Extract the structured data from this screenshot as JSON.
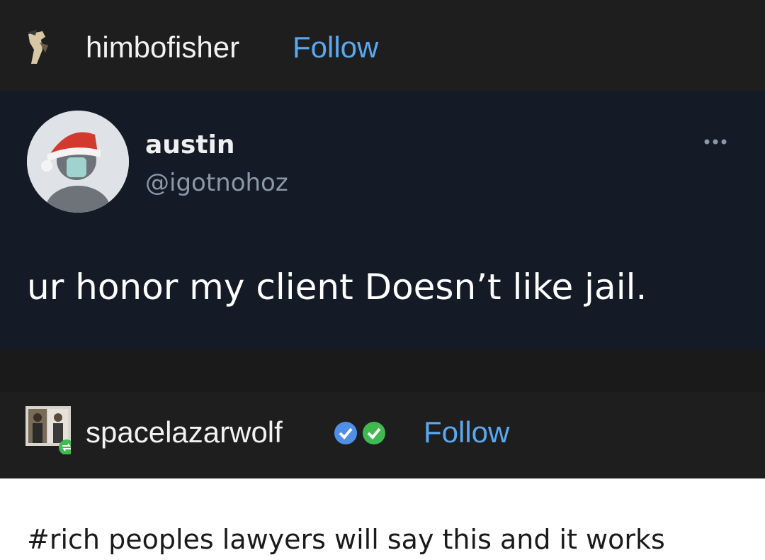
{
  "post": {
    "username": "himbofisher",
    "follow_label": "Follow",
    "avatar_icon": "user-avatar-icon"
  },
  "tweet": {
    "name": "austin",
    "handle": "@igotnohoz",
    "text": "ur honor my client Doesn’t like jail.",
    "more_icon": "more-options-icon"
  },
  "reblog": {
    "username": "spacelazarwolf",
    "follow_label": "Follow",
    "badges": [
      "verified-blue-icon",
      "verified-green-icon"
    ],
    "reblog_icon": "reblog-icon"
  },
  "comment": {
    "text": "#rich peoples lawyers will say this and it works"
  },
  "colors": {
    "follow": "#5aa8f0",
    "tweet_bg": "#141b27",
    "header_bg": "#1e1e1e",
    "reblog_badge": "#3fb950"
  }
}
